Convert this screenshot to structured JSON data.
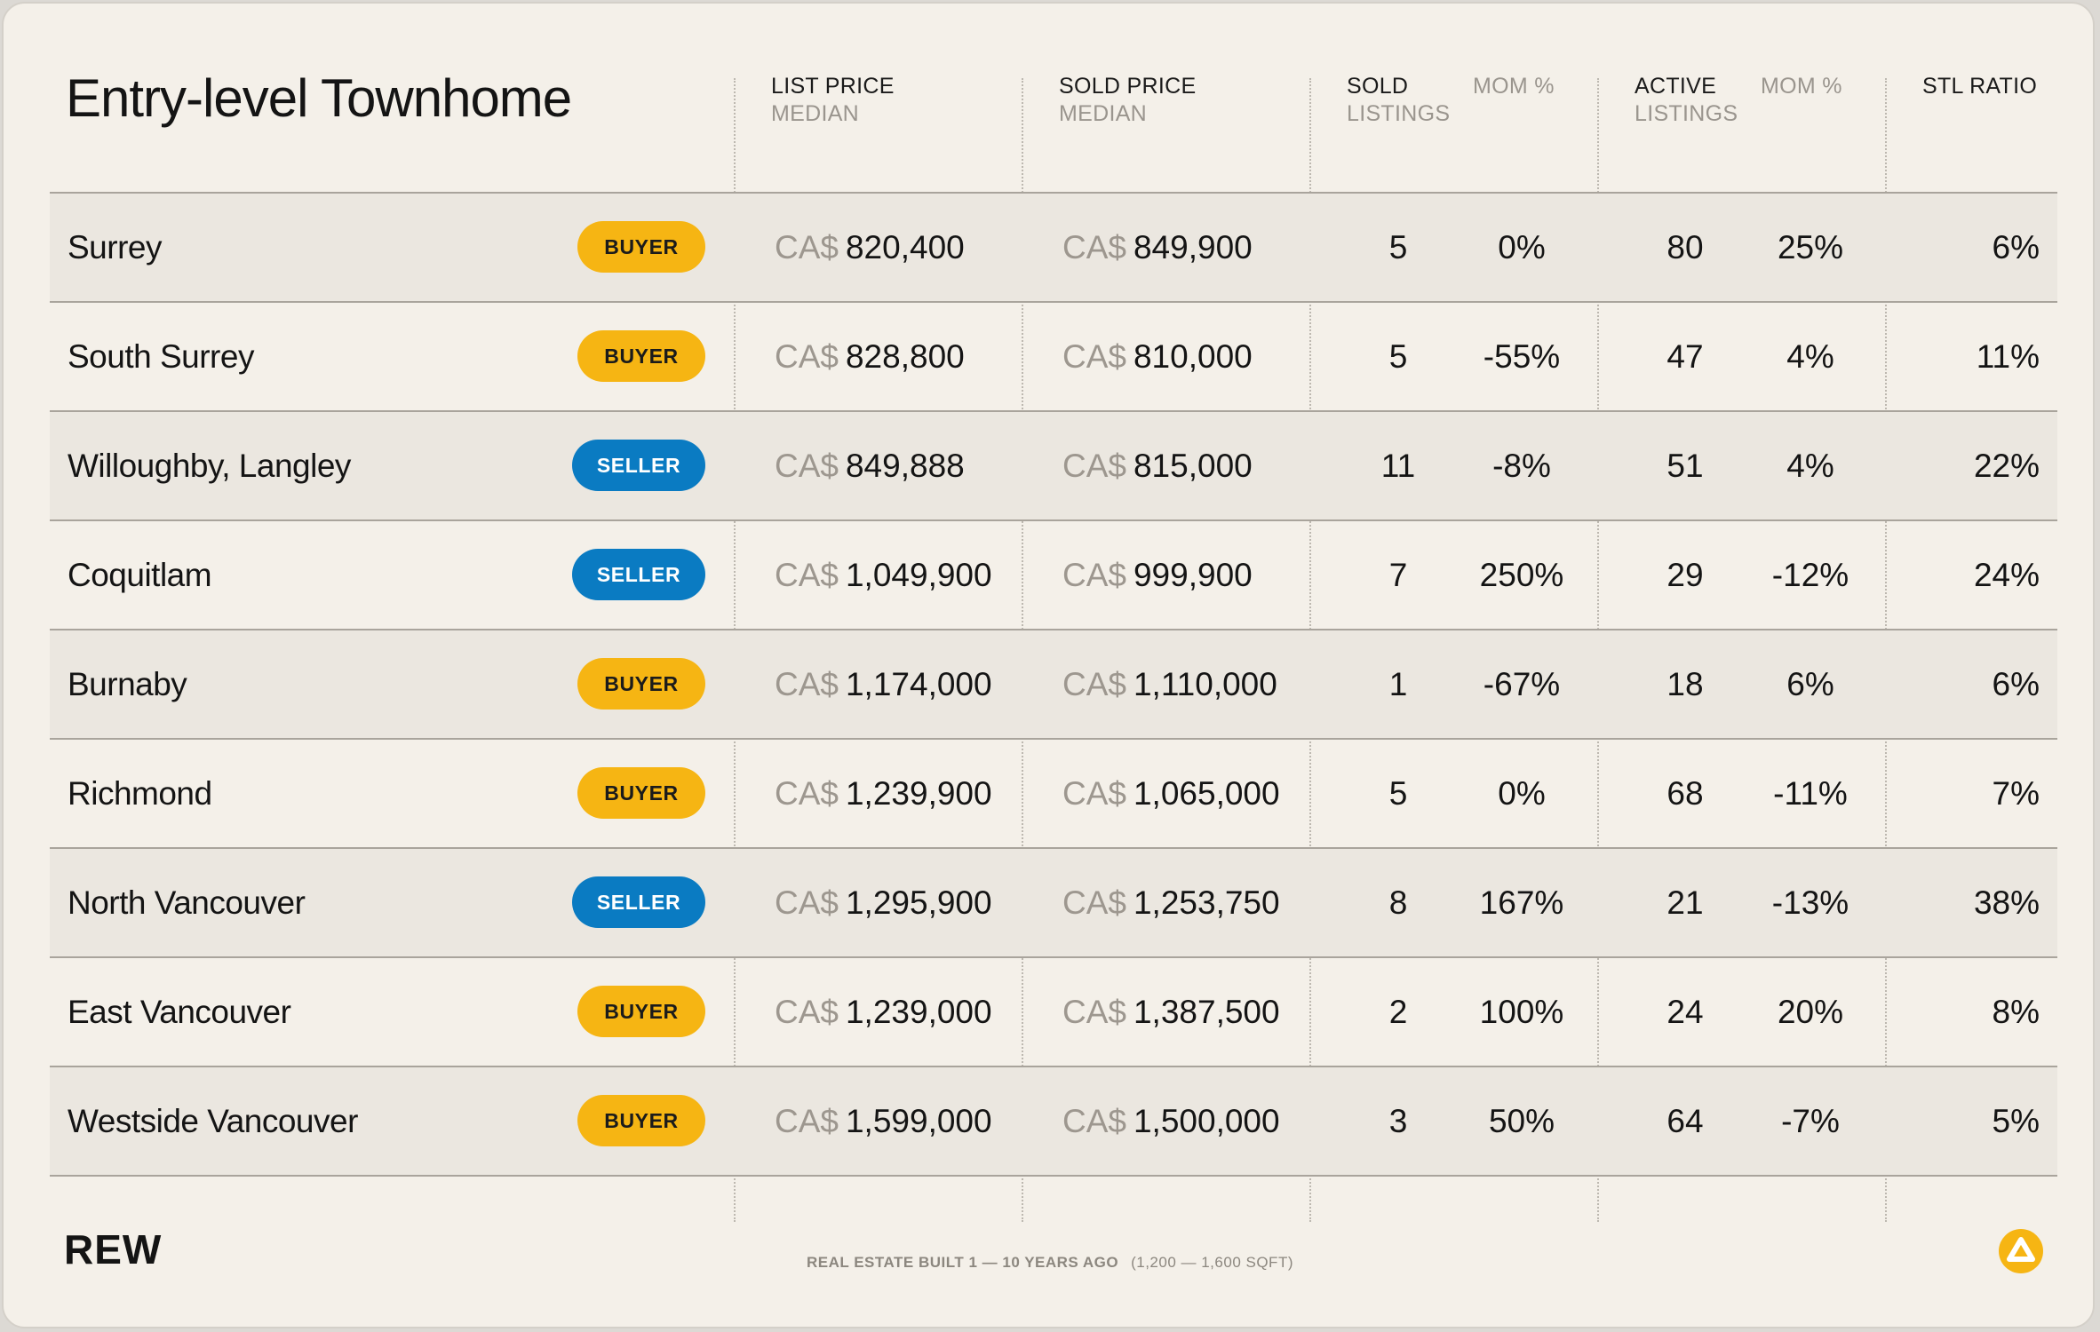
{
  "title": "Entry-level Townhome",
  "headers": {
    "list_price": "LIST PRICE",
    "list_price_sub": "MEDIAN",
    "sold_price": "SOLD PRICE",
    "sold_price_sub": "MEDIAN",
    "sold": "SOLD",
    "sold_sub": "LISTINGS",
    "sold_mom": "MOM %",
    "active": "ACTIVE",
    "active_sub": "LISTINGS",
    "active_mom": "MOM %",
    "stl": "STL RATIO"
  },
  "currency": "CA$",
  "rows": [
    {
      "name": "Surrey",
      "badge": "BUYER",
      "badge_type": "buyer",
      "list": "820,400",
      "sold_price": "849,900",
      "sold": "5",
      "sold_mom": "0%",
      "active": "80",
      "active_mom": "25%",
      "stl": "6%"
    },
    {
      "name": "South Surrey",
      "badge": "BUYER",
      "badge_type": "buyer",
      "list": "828,800",
      "sold_price": "810,000",
      "sold": "5",
      "sold_mom": "-55%",
      "active": "47",
      "active_mom": "4%",
      "stl": "11%"
    },
    {
      "name": "Willoughby, Langley",
      "badge": "SELLER",
      "badge_type": "seller",
      "list": "849,888",
      "sold_price": "815,000",
      "sold": "11",
      "sold_mom": "-8%",
      "active": "51",
      "active_mom": "4%",
      "stl": "22%"
    },
    {
      "name": "Coquitlam",
      "badge": "SELLER",
      "badge_type": "seller",
      "list": "1,049,900",
      "sold_price": "999,900",
      "sold": "7",
      "sold_mom": "250%",
      "active": "29",
      "active_mom": "-12%",
      "stl": "24%"
    },
    {
      "name": "Burnaby",
      "badge": "BUYER",
      "badge_type": "buyer",
      "list": "1,174,000",
      "sold_price": "1,110,000",
      "sold": "1",
      "sold_mom": "-67%",
      "active": "18",
      "active_mom": "6%",
      "stl": "6%"
    },
    {
      "name": "Richmond",
      "badge": "BUYER",
      "badge_type": "buyer",
      "list": "1,239,900",
      "sold_price": "1,065,000",
      "sold": "5",
      "sold_mom": "0%",
      "active": "68",
      "active_mom": "-11%",
      "stl": "7%"
    },
    {
      "name": "North Vancouver",
      "badge": "SELLER",
      "badge_type": "seller",
      "list": "1,295,900",
      "sold_price": "1,253,750",
      "sold": "8",
      "sold_mom": "167%",
      "active": "21",
      "active_mom": "-13%",
      "stl": "38%"
    },
    {
      "name": "East Vancouver",
      "badge": "BUYER",
      "badge_type": "buyer",
      "list": "1,239,000",
      "sold_price": "1,387,500",
      "sold": "2",
      "sold_mom": "100%",
      "active": "24",
      "active_mom": "20%",
      "stl": "8%"
    },
    {
      "name": "Westside Vancouver",
      "badge": "BUYER",
      "badge_type": "buyer",
      "list": "1,599,000",
      "sold_price": "1,500,000",
      "sold": "3",
      "sold_mom": "50%",
      "active": "64",
      "active_mom": "-7%",
      "stl": "5%"
    }
  ],
  "footer": {
    "brand": "REW",
    "note": "REAL ESTATE BUILT 1 — 10 YEARS AGO",
    "note_sub": "(1,200 — 1,600 SQFT)",
    "logo_icon": "rew-logo-icon",
    "logo_color": "#f6b513"
  },
  "colors": {
    "buyer": "#f6b513",
    "seller": "#0a7bc2",
    "background": "#f4f0e9"
  }
}
